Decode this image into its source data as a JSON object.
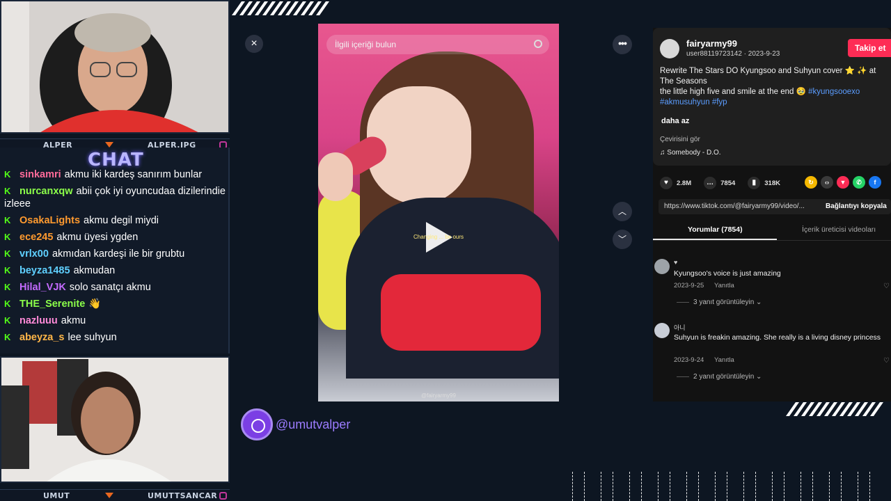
{
  "stream": {
    "cam_top": {
      "left_name": "ALPER",
      "right_name": "ALPER.JPG"
    },
    "cam_bottom": {
      "left_name": "UMUT",
      "right_name": "UMUTTSANCAR"
    },
    "chat_title": "CHAT",
    "chat": [
      {
        "user": "sinkamri",
        "color": "#ff6b9a",
        "msg": "akmu iki kardeş sanırım bunlar"
      },
      {
        "user": "nurcanxqw",
        "color": "#8cff4a",
        "msg": "abii çok iyi oyuncudaa dizilerindie izleee"
      },
      {
        "user": "OsakaLights",
        "color": "#ff9a2f",
        "msg": "akmu degil miydi"
      },
      {
        "user": "ece245",
        "color": "#ff9a2f",
        "msg": "akmu üyesi ygden"
      },
      {
        "user": "vrlx00",
        "color": "#5fd0ff",
        "msg": "akmıdan kardeşi ile bir grubtu"
      },
      {
        "user": "beyza1485",
        "color": "#5fd0ff",
        "msg": "akmudan"
      },
      {
        "user": "Hilal_VJK",
        "color": "#c46bff",
        "msg": "solo sanatçı akmu"
      },
      {
        "user": "THE_Serenite",
        "color": "#8cff4a",
        "msg": "👋"
      },
      {
        "user": "nazluuu",
        "color": "#ff8ad8",
        "msg": "akmu"
      },
      {
        "user": "abeyza_s",
        "color": "#ffb648",
        "msg": "lee suhyun"
      }
    ],
    "handle": "@umutvalper"
  },
  "video": {
    "search_placeholder": "İlgili içeriği bulun",
    "subtitle": "Changing ... be ours",
    "watermark": "@fairyarmy99",
    "close_icon": "×",
    "more_icon": "•••",
    "up_icon": "︿",
    "down_icon": "﹀"
  },
  "post": {
    "username": "fairyarmy99",
    "user_meta": "user88119723142 · 2023-9-23",
    "follow_label": "Takip et",
    "description_line1": "Rewrite The Stars DO Kyungsoo and Suhyun cover ⭐ ✨ at The Seasons",
    "description_line2": "the little high five and smile at the end 🥹 ",
    "hashtag1": "#kyungsooexo",
    "hashtag2": "#akmusuhyun",
    "hashtag3": "#fyp",
    "less_label": "daha az",
    "translate_label": "Çevirisini gör",
    "music": "♫  Somebody - D.O.",
    "likes": "2.8M",
    "comments": "7854",
    "saves": "318K",
    "link": "https://www.tiktok.com/@fairyarmy99/video/...",
    "copy_link_label": "Bağlantıyı kopyala",
    "tab_comments": "Yorumlar (7854)",
    "tab_creator": "İçerik üreticisi videoları"
  },
  "comments": [
    {
      "name": "♥",
      "text": "Kyungsoo's voice is just amazing",
      "date": "2023-9-25",
      "reply": "Yanıtla",
      "replies": "3 yanıt görüntüleyin ⌄"
    },
    {
      "name": "아니",
      "text": "Suhyun is freakin amazing. She really is a living disney princess",
      "date": "2023-9-24",
      "reply": "Yanıtla",
      "replies": "2 yanıt görüntüleyin ⌄"
    }
  ],
  "colors": {
    "accent": "#fe2c55",
    "link": "#5b9dff",
    "kick": "#53fc18",
    "handle": "#9b7cff"
  }
}
